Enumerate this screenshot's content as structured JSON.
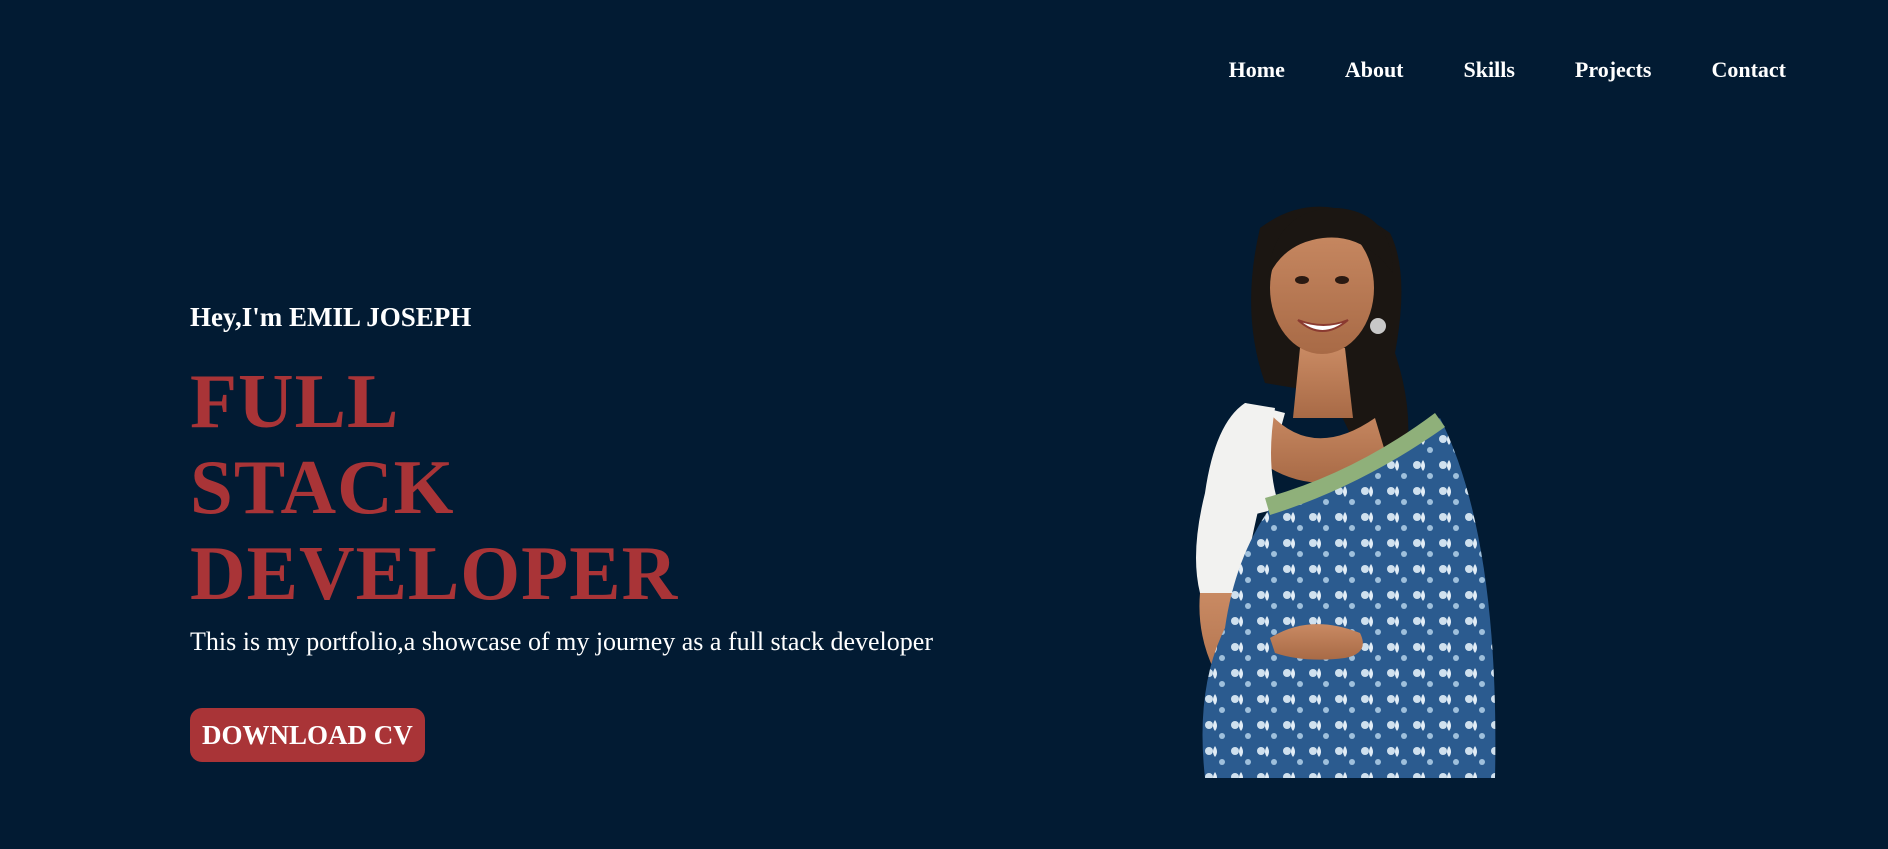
{
  "nav": {
    "items": [
      {
        "label": "Home"
      },
      {
        "label": "About"
      },
      {
        "label": "Skills"
      },
      {
        "label": "Projects"
      },
      {
        "label": "Contact"
      }
    ]
  },
  "hero": {
    "greeting": "Hey,I'm EMIL JOSEPH",
    "role_lines": [
      "FULL",
      "STACK",
      "DEVELOPER"
    ],
    "tagline": "This is my portfolio,a showcase of my journey as a full stack developer",
    "cta_label": "DOWNLOAD CV"
  },
  "colors": {
    "background": "#021b33",
    "accent": "#a93437",
    "text": "#ffffff"
  }
}
